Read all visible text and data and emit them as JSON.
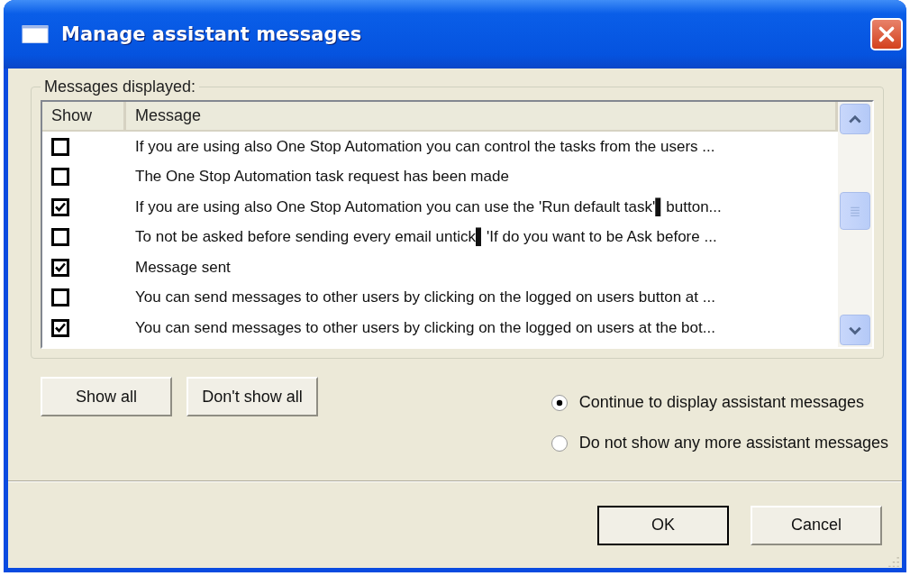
{
  "window": {
    "title": "Manage assistant messages"
  },
  "group": {
    "label": "Messages displayed:"
  },
  "table": {
    "columns": [
      "Show",
      "Message"
    ],
    "rows": [
      {
        "checked": false,
        "message": "If you are using also One Stop Automation you can control the tasks from the users ..."
      },
      {
        "checked": false,
        "message": "The One Stop Automation task request has been made"
      },
      {
        "checked": true,
        "message": "If you are using also One Stop Automation you can use the 'Run default task'▌button..."
      },
      {
        "checked": false,
        "message": "To not be asked before sending every email untick▌'If do you want to be Ask before ..."
      },
      {
        "checked": true,
        "message": "Message sent"
      },
      {
        "checked": false,
        "message": "You can send messages to other users by clicking on the logged on users button at ..."
      },
      {
        "checked": true,
        "message": "You can send messages to other users by clicking on the logged on users at the bot..."
      }
    ]
  },
  "list_buttons": [
    {
      "label": "Show all"
    },
    {
      "label": "Don't show all"
    }
  ],
  "options": [
    {
      "label": "Continue to display assistant messages",
      "selected": true
    },
    {
      "label": "Do not show any more assistant messages",
      "selected": false
    }
  ],
  "buttons": [
    {
      "label": "OK",
      "default": true
    },
    {
      "label": "Cancel",
      "default": false
    }
  ]
}
